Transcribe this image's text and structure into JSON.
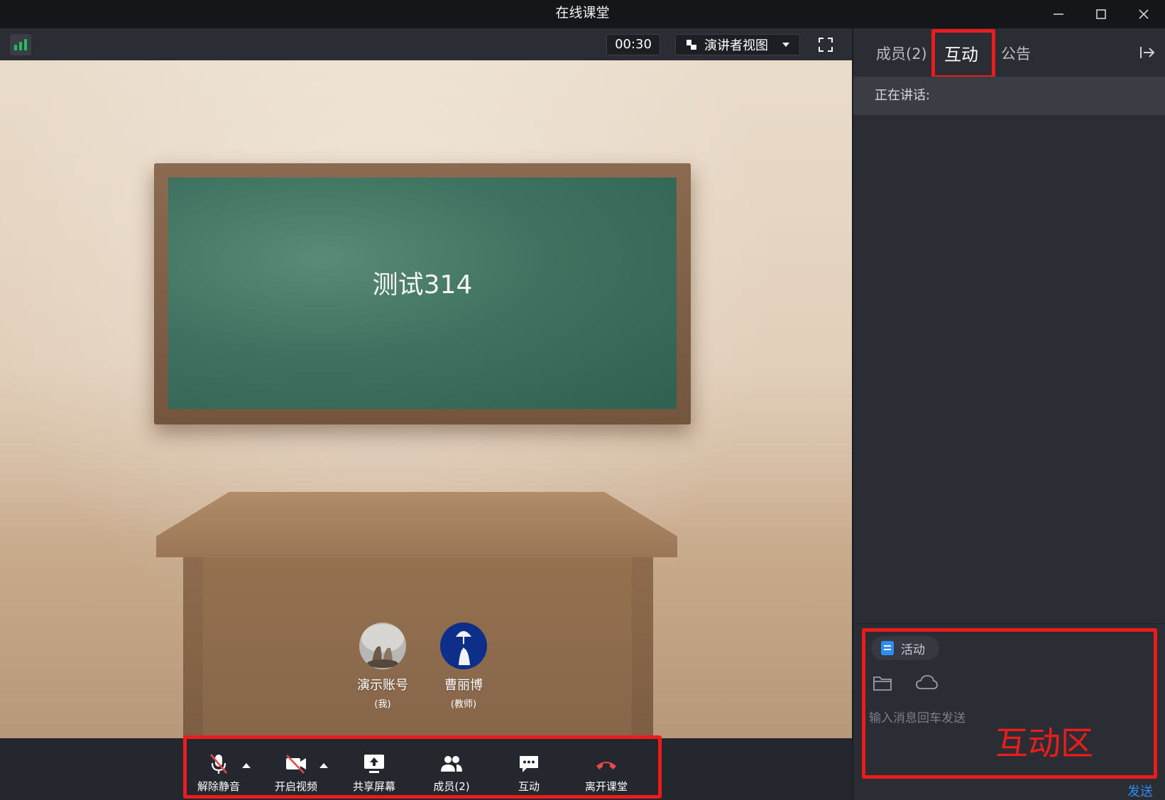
{
  "window": {
    "title": "在线课堂",
    "controls": [
      "minimize-icon",
      "maximize-icon",
      "close-icon"
    ]
  },
  "video_toolbar": {
    "signal_icon": "signal-bars-icon",
    "timer": "00:30",
    "view_mode": "演讲者视图",
    "fullscreen_icon": "fullscreen-icon"
  },
  "stage": {
    "board_text": "测试314",
    "participants": [
      {
        "name": "演示账号",
        "role": "(我)"
      },
      {
        "name": "曹丽博",
        "role": "(教师)"
      }
    ]
  },
  "controls": {
    "unmute": "解除静音",
    "start_video": "开启视频",
    "share_screen": "共享屏幕",
    "members": "成员(2)",
    "interact": "互动",
    "leave": "离开课堂",
    "leave_color": "#e5484d"
  },
  "side_panel": {
    "tabs": [
      {
        "label": "成员(2)",
        "active": false
      },
      {
        "label": "互动",
        "active": true
      },
      {
        "label": "公告",
        "active": false
      }
    ],
    "speaking_label": "正在讲话:",
    "activity_chip": "活动",
    "input_placeholder": "输入消息回车发送",
    "zone_annotation": "互动区",
    "send_label": "发送"
  },
  "colors": {
    "highlight": "#ec1c1c",
    "accent_blue": "#2f8cf0",
    "signal_green": "#20c05c"
  }
}
